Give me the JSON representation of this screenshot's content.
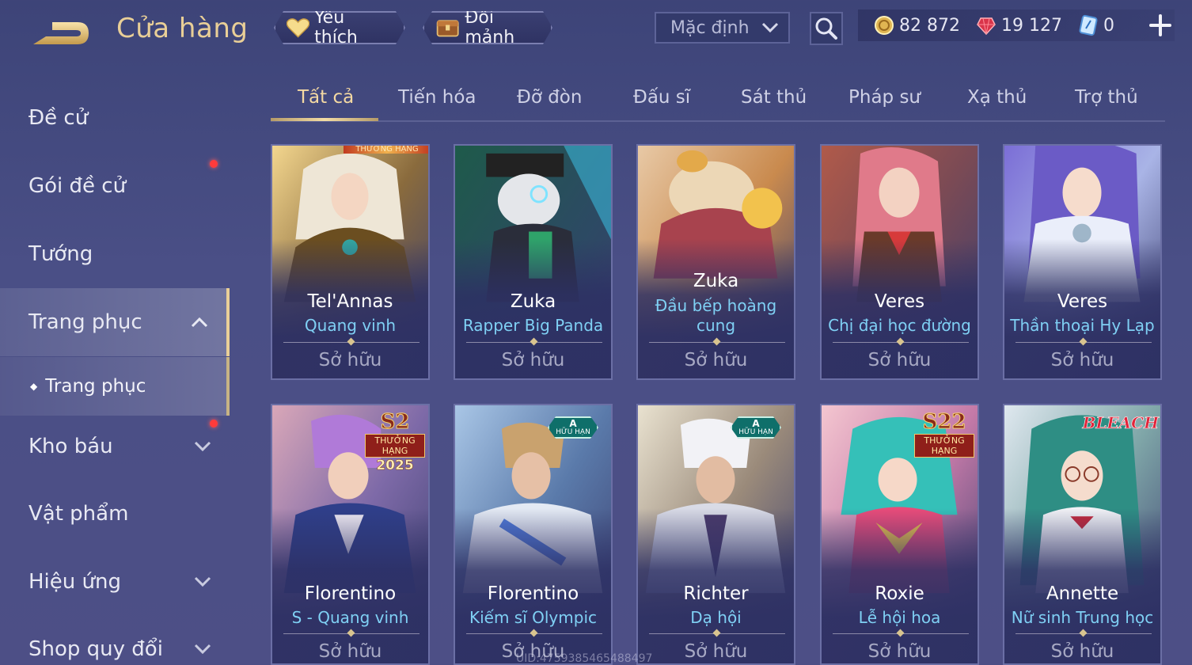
{
  "header": {
    "title": "Cửa hàng",
    "favorites_label": "Yêu thích",
    "exchange_label": "Đổi mảnh",
    "sort_value": "Mặc định",
    "currencies": [
      {
        "icon": "gold-coin-icon",
        "value": "82 872"
      },
      {
        "icon": "red-gem-icon",
        "value": "19 127"
      },
      {
        "icon": "voucher-icon",
        "value": "0"
      }
    ]
  },
  "sidebar": {
    "items": [
      {
        "label": "Đề cử"
      },
      {
        "label": "Gói đề cử"
      },
      {
        "label": "Tướng"
      },
      {
        "label": "Trang phục"
      },
      {
        "label": "Kho báu"
      },
      {
        "label": "Vật phẩm"
      },
      {
        "label": "Hiệu ứng"
      },
      {
        "label": "Shop quy đổi"
      }
    ],
    "sub_item": "Trang phục"
  },
  "tabs": [
    "Tất cả",
    "Tiến hóa",
    "Đỡ đòn",
    "Đấu sĩ",
    "Sát thủ",
    "Pháp sư",
    "Xạ thủ",
    "Trợ thủ"
  ],
  "cards": [
    {
      "hero": "Tel'Annas",
      "skin": "Quang vinh",
      "status": "Sở hữu",
      "strip": "THƯỞNG HẠNG"
    },
    {
      "hero": "Zuka",
      "skin": "Rapper Big Panda",
      "status": "Sở hữu"
    },
    {
      "hero": "Zuka",
      "skin": "Đầu bếp hoàng cung",
      "status": "Sở hữu"
    },
    {
      "hero": "Veres",
      "skin": "Chị đại học đường",
      "status": "Sở hữu"
    },
    {
      "hero": "Veres",
      "skin": "Thần thoại Hy Lạp",
      "status": "Sở hữu"
    },
    {
      "hero": "Florentino",
      "skin": "S - Quang vinh",
      "status": "Sở hữu",
      "badge": {
        "season": "S2",
        "rank": "THƯỞNG HẠNG",
        "year": "2025"
      }
    },
    {
      "hero": "Florentino",
      "skin": "Kiếm sĩ Olympic",
      "status": "Sở hữu",
      "badge": {
        "grade": "A",
        "label": "HỮU HẠN"
      }
    },
    {
      "hero": "Richter",
      "skin": "Dạ hội",
      "status": "Sở hữu",
      "badge": {
        "grade": "A",
        "label": "HỮU HẠN"
      }
    },
    {
      "hero": "Roxie",
      "skin": "Lễ hội hoa",
      "status": "Sở hữu",
      "badge": {
        "season": "S22",
        "rank": "THƯỞNG HẠNG"
      }
    },
    {
      "hero": "Annette",
      "skin": "Nữ sinh Trung học",
      "status": "Sở hữu",
      "badge": {
        "collab": "BLEACH"
      }
    }
  ],
  "uid_text": "UID:4759385465488497",
  "colors": {
    "accent_gold": "#e9cf97",
    "skin_name": "#7fd0f4",
    "bg": "#464b82",
    "notification": "#ff3b3b"
  }
}
